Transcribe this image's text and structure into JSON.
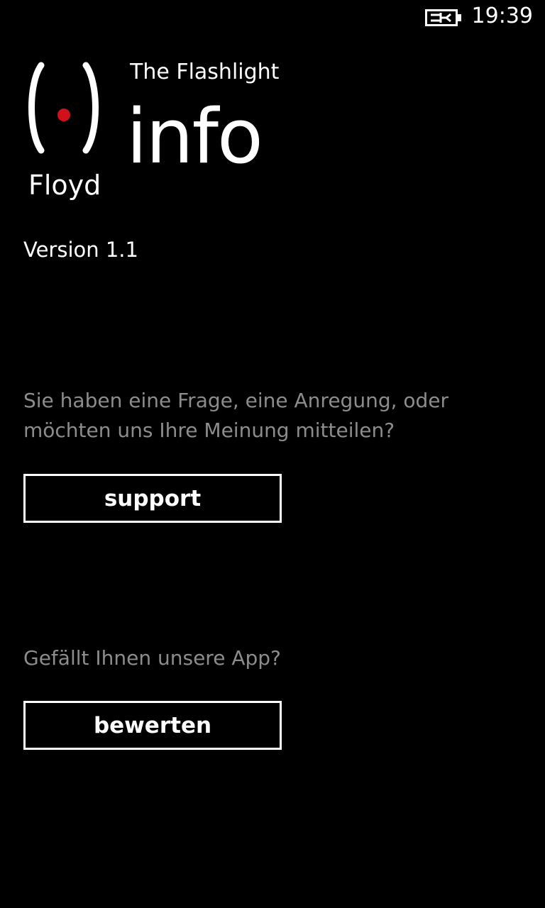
{
  "status_bar": {
    "time": "19:39",
    "battery_icon": "battery-charging-icon"
  },
  "logo": {
    "icon": "floyd-logo-icon",
    "text": "Floyd",
    "accent_color": "#d0101a"
  },
  "header": {
    "app_name": "The Flashlight",
    "page_title": "info"
  },
  "main": {
    "version": "Version 1.1",
    "support_prompt": "Sie haben eine Frage, eine Anregung, oder möchten uns Ihre Meinung mitteilen?",
    "support_button_label": "support",
    "rate_prompt": "Gefällt Ihnen unsere App?",
    "rate_button_label": "bewerten"
  },
  "colors": {
    "background": "#000000",
    "foreground": "#ffffff",
    "subtle_text": "#8c8c8c"
  }
}
